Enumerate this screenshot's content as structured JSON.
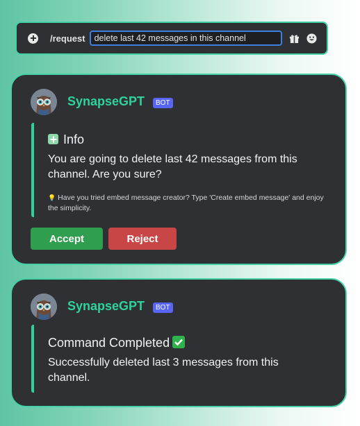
{
  "command_bar": {
    "command": "/request",
    "input_value": "delete last 42 messages in this channel",
    "icons": [
      "plus-icon",
      "gift-icon",
      "emoji-icon"
    ]
  },
  "messages": [
    {
      "bot_name": "SynapseGPT",
      "badge": "BOT",
      "embed_title": "Info",
      "embed_body": "You are going to delete last 42 messages from this channel. Are you sure?",
      "tip_emoji": "💡",
      "tip": "Have you tried embed message creator? Type 'Create embed message' and enjoy the simplicity.",
      "accept_label": "Accept",
      "reject_label": "Reject"
    },
    {
      "bot_name": "SynapseGPT",
      "badge": "BOT",
      "embed_title": "Command Completed",
      "embed_body": "Successfully deleted last 3 messages from this channel."
    }
  ],
  "colors": {
    "accent": "#45d2a8",
    "bot_name": "#2fd29e",
    "card_bg": "#2f3033",
    "accept": "#2f9e4e",
    "reject": "#c94646",
    "badge": "#5865f2"
  }
}
